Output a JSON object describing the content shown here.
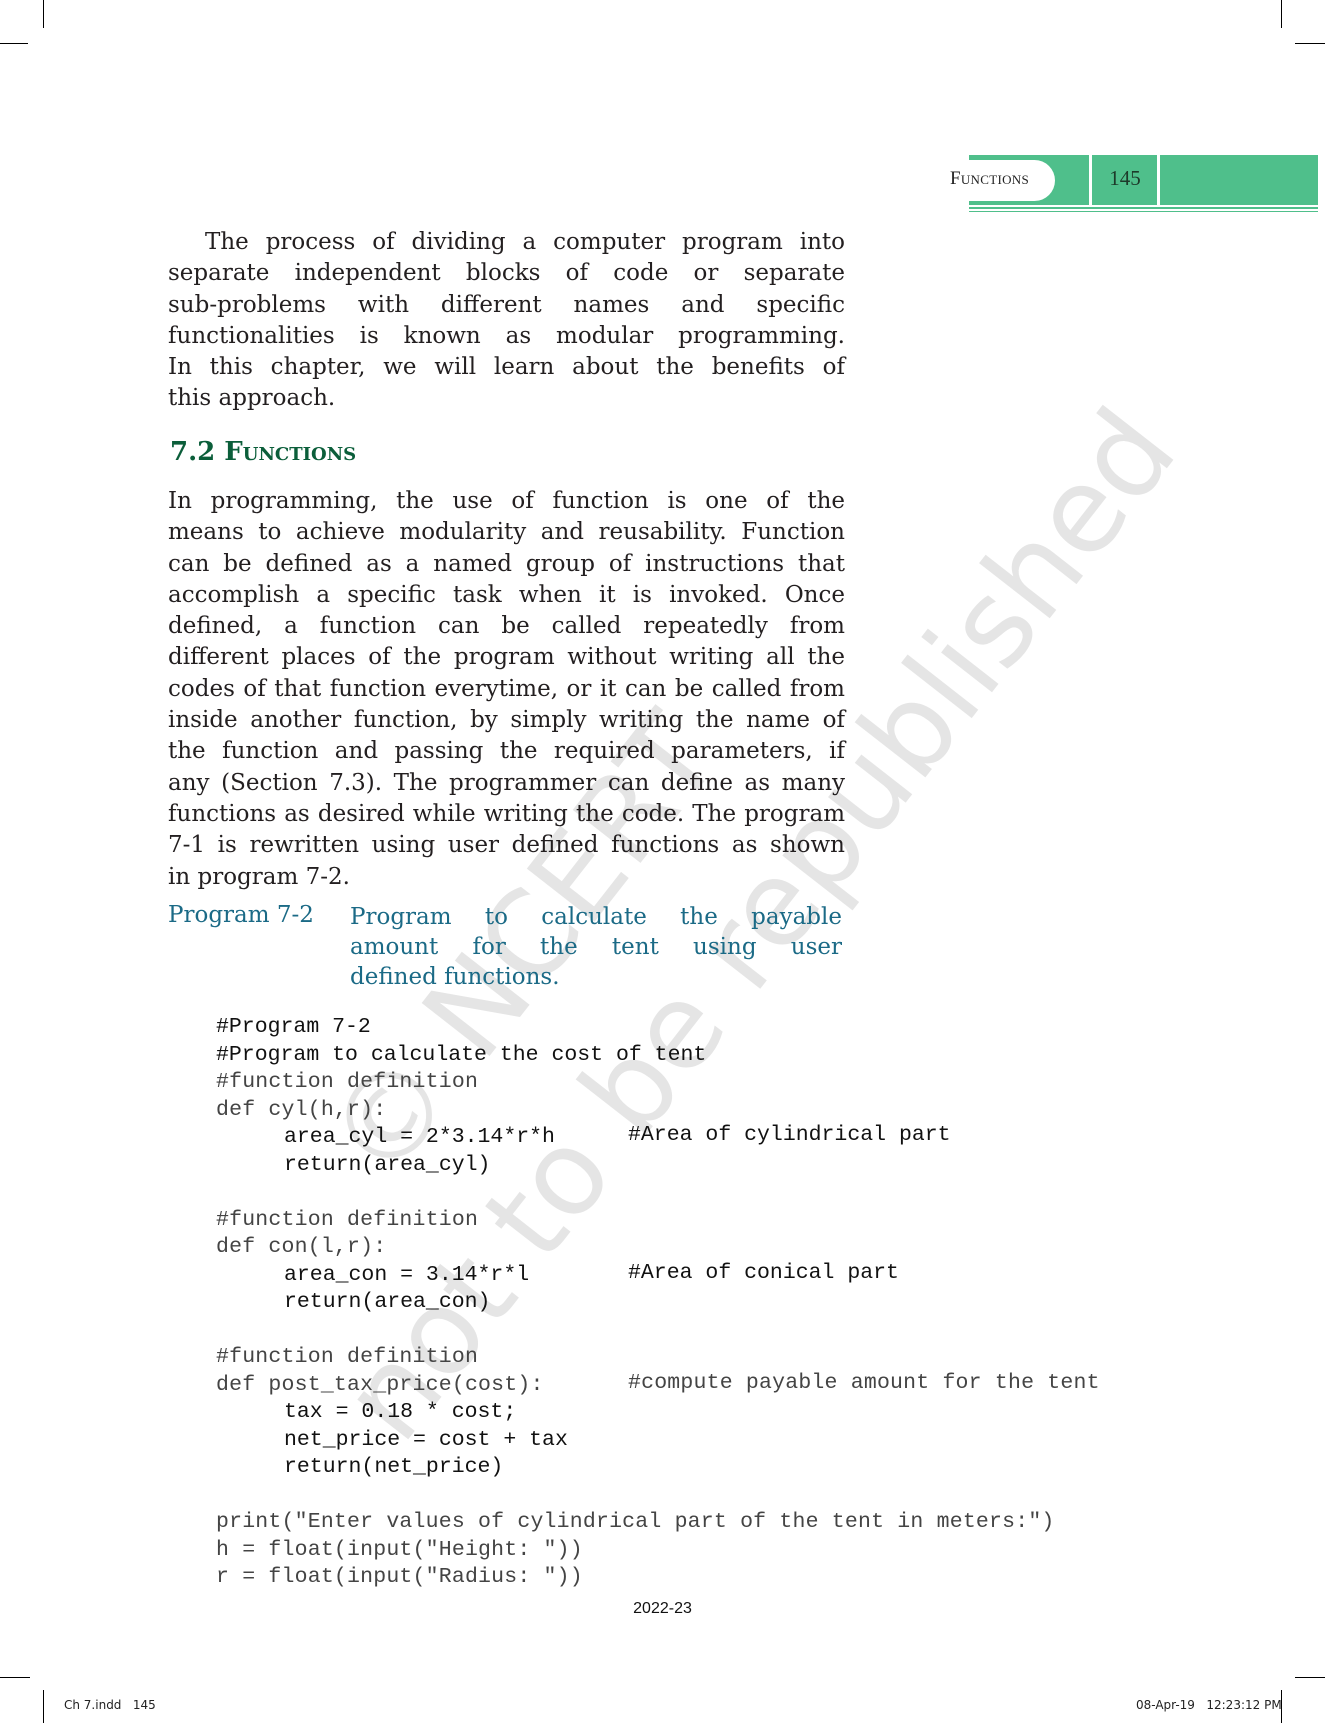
{
  "header": {
    "section_title": "Functions",
    "page_number": "145",
    "accent_color": "#4fbf8b"
  },
  "intro_paragraph": {
    "lines": [
      "The process of dividing a computer program into",
      "separate independent blocks of code or separate",
      "sub-problems with different names and specific",
      "functionalities is known as modular programming.",
      "In this chapter, we will learn about the benefits of",
      "this approach."
    ]
  },
  "section": {
    "number": "7.2",
    "title": "Functions",
    "heading_color": "#0b5e3a"
  },
  "section_paragraph": {
    "lines": [
      "In programming, the use of function is one of the",
      "means to achieve modularity and reusability. Function",
      "can be defined as a named group of instructions that",
      "accomplish a specific task when it is invoked. Once",
      "defined, a function can be called repeatedly from",
      "different places of the program without writing all the",
      "codes of that function everytime, or it can be called from",
      "inside another function, by simply writing the name of",
      "the function and passing the required parameters, if",
      "any (Section 7.3). The programmer can define as many",
      "functions as desired while writing the code. The program",
      "7-1 is rewritten using user defined functions as shown",
      "in program 7-2."
    ]
  },
  "program_caption": {
    "label": "Program 7-2",
    "lines": [
      "Program to calculate the payable",
      "amount for the tent using user",
      "defined functions."
    ],
    "color": "#1b6a86"
  },
  "code": {
    "lines": [
      {
        "text": "#Program 7-2",
        "style": "dark",
        "indent": false,
        "comment": ""
      },
      {
        "text": "#Program to calculate the cost of tent",
        "style": "dark",
        "indent": false,
        "comment": ""
      },
      {
        "text": "#function definition",
        "style": "light",
        "indent": false,
        "comment": ""
      },
      {
        "text": "def cyl(h,r):",
        "style": "light",
        "indent": false,
        "comment": ""
      },
      {
        "text": "area_cyl = 2*3.14*r*h",
        "style": "dark",
        "indent": true,
        "comment": "#Area of cylindrical part"
      },
      {
        "text": "return(area_cyl)",
        "style": "dark",
        "indent": true,
        "comment": ""
      },
      {
        "text": "",
        "style": "dark",
        "indent": false,
        "comment": ""
      },
      {
        "text": "#function definition",
        "style": "light",
        "indent": false,
        "comment": ""
      },
      {
        "text": "def con(l,r):",
        "style": "light",
        "indent": false,
        "comment": ""
      },
      {
        "text": "area_con = 3.14*r*l",
        "style": "dark",
        "indent": true,
        "comment": "#Area of conical part"
      },
      {
        "text": "return(area_con)",
        "style": "dark",
        "indent": true,
        "comment": ""
      },
      {
        "text": "",
        "style": "dark",
        "indent": false,
        "comment": ""
      },
      {
        "text": "#function definition",
        "style": "light",
        "indent": false,
        "comment": ""
      },
      {
        "text": "def post_tax_price(cost):",
        "style": "light",
        "indent": false,
        "comment": "#compute payable amount for the tent"
      },
      {
        "text": "tax = 0.18 * cost;",
        "style": "dark",
        "indent": true,
        "comment": ""
      },
      {
        "text": "net_price = cost + tax",
        "style": "dark",
        "indent": true,
        "comment": ""
      },
      {
        "text": "return(net_price)",
        "style": "dark",
        "indent": true,
        "comment": ""
      },
      {
        "text": "",
        "style": "dark",
        "indent": false,
        "comment": ""
      },
      {
        "text": "print(\"Enter values of cylindrical part of the tent in meters:\")",
        "style": "light",
        "indent": false,
        "comment": ""
      },
      {
        "text": "h = float(input(\"Height: \"))",
        "style": "light",
        "indent": false,
        "comment": ""
      },
      {
        "text": "r = float(input(\"Radius: \"))",
        "style": "light",
        "indent": false,
        "comment": ""
      }
    ]
  },
  "footer": {
    "year": "2022-23",
    "slug_left": "Ch 7.indd   145",
    "slug_right": "08-Apr-19   12:23:12 PM"
  },
  "watermark": {
    "line1": "© NCERT",
    "line2": "not to be republished"
  }
}
